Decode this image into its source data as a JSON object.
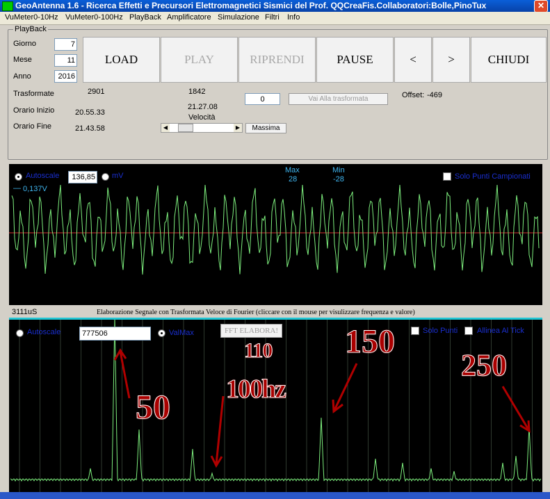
{
  "window": {
    "title": "GeoAntenna 1.6 - Ricerca Effetti e Precursori Elettromagnetici Sismici del Prof. QQCreaFis.Collaboratori:Bolle,PinoTux",
    "close_glyph": "✕"
  },
  "menu": [
    "VuMeter0-10Hz",
    "VuMeter0-100Hz",
    "PlayBack",
    "Amplificatore",
    "Simulazione",
    "Filtri",
    "Info"
  ],
  "playback": {
    "legend": "PlayBack",
    "giorno_label": "Giorno",
    "giorno_value": "7",
    "mese_label": "Mese",
    "mese_value": "11",
    "anno_label": "Anno",
    "anno_value": "2016",
    "buttons": {
      "load": "LOAD",
      "play": "PLAY",
      "riprendi": "RIPRENDI",
      "pause": "PAUSE",
      "prev": "<",
      "next": ">",
      "chiudi": "CHIUDI"
    },
    "trasformate_label": "Trasformate",
    "trasformate_value": "2901",
    "trasformate_value2": "1842",
    "orario_inizio_label": "Orario Inizio",
    "orario_inizio_value": "20.55.33",
    "orario_fine_label": "Orario Fine",
    "orario_fine_value": "21.43.58",
    "current_time": "21.27.08",
    "velocita_label": "Velocità",
    "massima_button": "Massima",
    "goto_value": "0",
    "vai_button": "Vai Alla trasformata",
    "offset_label": "Offset:",
    "offset_value": "-469",
    "speed_slider_position": 0.15
  },
  "scope": {
    "autoscale_label": "Autoscale",
    "scale_value": "136,85",
    "mv_label": "mV",
    "max_label": "Max",
    "max_value": "28",
    "min_label": "Min",
    "min_value": "-28",
    "solo_punti_label": "Solo Punti Campionati",
    "voltage_label": "0,137V",
    "time_label": "3111uS"
  },
  "fft": {
    "header": "Elaborazione Segnale con Trasformata Veloce di Fourier (cliccare con il mouse per visulizzare frequenza e valore)",
    "autoscale_label": "Autoscale",
    "value": "777506",
    "valmax_label": "ValMax",
    "elabora_button": "FFT ELABORA!",
    "solo_punti_label": "Solo Punti",
    "allinea_label": "Allinea Al Tick"
  },
  "annotations": {
    "a50": "50",
    "a100": "100hz",
    "a110": "110",
    "a150": "150",
    "a250": "250"
  },
  "colors": {
    "trace": "#7ef07e",
    "zero_line": "#d23030",
    "annotation": "#aa0000",
    "fft_header_bar": "#21c6d4"
  }
}
